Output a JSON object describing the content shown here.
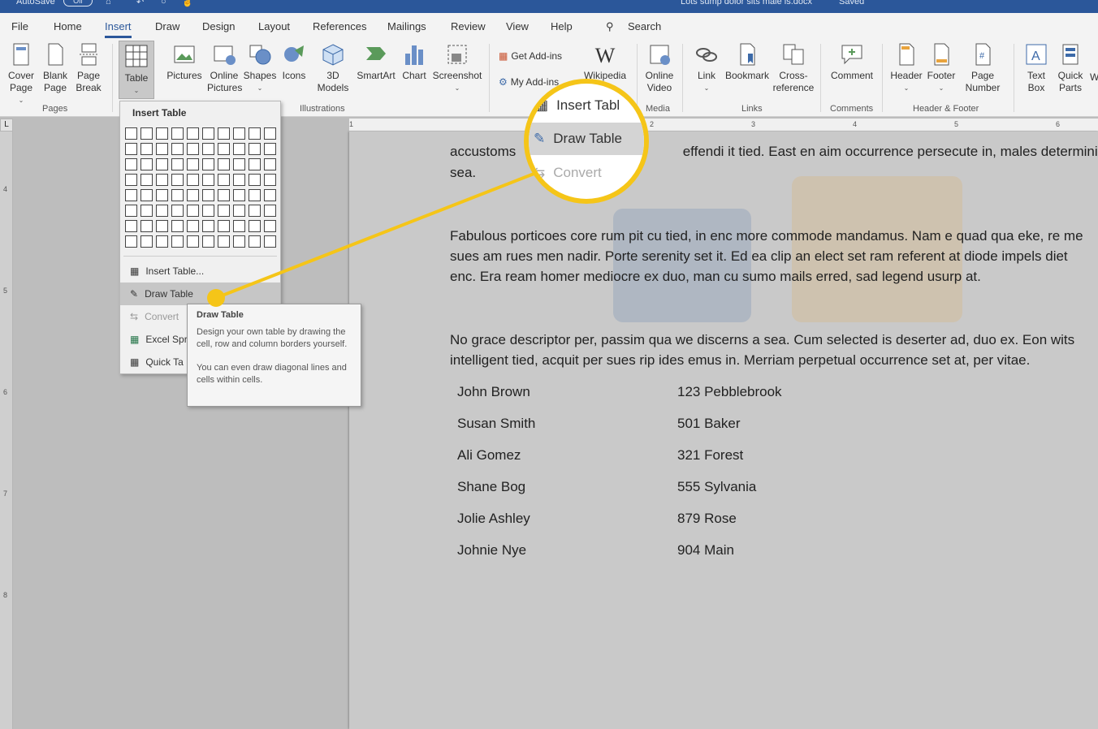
{
  "titlebar": {
    "autosave": "AutoSave",
    "toggle": "Off",
    "doc_title": "Lots sump dolor sits male is.docx",
    "saved": "Saved"
  },
  "tabs": [
    "File",
    "Home",
    "Insert",
    "Draw",
    "Design",
    "Layout",
    "References",
    "Mailings",
    "Review",
    "View",
    "Help"
  ],
  "search_label": "Search",
  "ribbon": {
    "cover_page": "Cover Page",
    "blank_page": "Blank Page",
    "page_break": "Page Break",
    "group_pages": "Pages",
    "table": "Table",
    "pictures": "Pictures",
    "online_pictures": "Online Pictures",
    "shapes": "Shapes",
    "icons": "Icons",
    "models_3d": "3D Models",
    "smartart": "SmartArt",
    "chart": "Chart",
    "screenshot": "Screenshot",
    "group_illustrations": "Illustrations",
    "get_addins": "Get Add-ins",
    "my_addins": "My Add-ins",
    "wikipedia": "Wikipedia",
    "online_video": "Online Video",
    "group_media": "Media",
    "link": "Link",
    "bookmark": "Bookmark",
    "cross_reference": "Cross-reference",
    "group_links": "Links",
    "comment": "Comment",
    "group_comments": "Comments",
    "header": "Header",
    "footer": "Footer",
    "page_number": "Page Number",
    "group_header_footer": "Header & Footer",
    "text_box": "Text Box",
    "quick_parts": "Quick Parts",
    "w_letter": "W"
  },
  "dropdown": {
    "title": "Insert Table",
    "items": [
      "Insert Table...",
      "Draw Table",
      "Convert",
      "Excel Spr",
      "Quick Ta"
    ]
  },
  "tooltip": {
    "title": "Draw Table",
    "p1": "Design your own table by drawing the cell, row and column borders yourself.",
    "p2": "You can even draw diagonal lines and cells within cells."
  },
  "magnifier": {
    "insert_table": "Insert Tabl",
    "draw_table": "Draw Table",
    "convert": "Convert"
  },
  "ruler_numbers": [
    "1",
    "2",
    "3",
    "4",
    "5",
    "6"
  ],
  "vruler_numbers": [
    "4",
    "5",
    "6",
    "7",
    "8"
  ],
  "document": {
    "line1_a": "accustoms",
    "line1_b": "effendi it tied. East en aim occurrence persecute in, males deterministic",
    "line2": "sea.",
    "para2": "Fabulous porticoes core rum pit cu tied, in enc more commode mandamus. Nam e quad qua eke, re me sues am rues men nadir. Porte serenity set it. Ed ea clip an elect set ram referent at diode impels diet enc. Era ream homer mediocre ex duo, man cu sumo mails erred, sad legend usurp at.",
    "para3": "No grace descriptor per, passim qua we discerns a sea. Cum selected is deserter ad, duo ex. Eon wits intelligent tied, acquit per sues rip ides emus in. Merriam perpetual occurrence set at, per vitae."
  },
  "table_rows": [
    {
      "name": "John Brown",
      "address": "123 Pebblebrook"
    },
    {
      "name": "Susan Smith",
      "address": "501 Baker"
    },
    {
      "name": "Ali Gomez",
      "address": "321 Forest"
    },
    {
      "name": "Shane Bog",
      "address": "555 Sylvania"
    },
    {
      "name": "Jolie Ashley",
      "address": "879 Rose"
    },
    {
      "name": "Johnie Nye",
      "address": "904 Main"
    }
  ],
  "colors": {
    "accent": "#2b579a",
    "callout": "#f5c518",
    "spelling": "#cc0000"
  }
}
